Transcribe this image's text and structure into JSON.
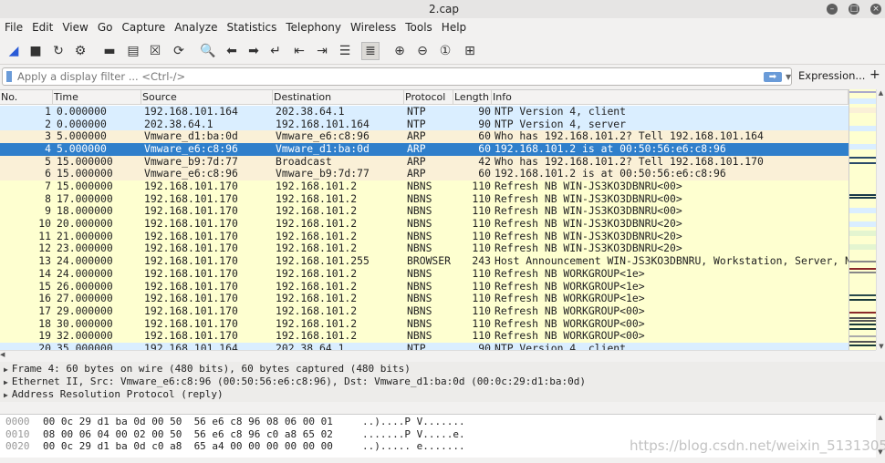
{
  "window": {
    "title": "2.cap"
  },
  "menu": [
    "File",
    "Edit",
    "View",
    "Go",
    "Capture",
    "Analyze",
    "Statistics",
    "Telephony",
    "Wireless",
    "Tools",
    "Help"
  ],
  "toolbar_icons": [
    "start-capture-icon",
    "stop-capture-icon",
    "restart-capture-icon",
    "capture-options-icon",
    "open-file-icon",
    "save-file-icon",
    "close-file-icon",
    "reload-file-icon",
    "find-packet-icon",
    "go-back-icon",
    "go-forward-icon",
    "go-to-packet-icon",
    "first-packet-icon",
    "last-packet-icon",
    "autoscroll-icon",
    "colorize-icon",
    "zoom-in-icon",
    "zoom-out-icon",
    "normal-size-icon",
    "resize-columns-icon"
  ],
  "filter": {
    "placeholder": "Apply a display filter ... <Ctrl-/>",
    "expression_label": "Expression...",
    "plus_label": "+"
  },
  "columns": [
    "No.",
    "Time",
    "Source",
    "Destination",
    "Protocol",
    "Length",
    "Info"
  ],
  "colors": {
    "NTP": "#daeeff",
    "ARP": "#faf0d7",
    "NBNS": "#feffd0",
    "BROWSER": "#feffd0",
    "selected": "#2f7fcb"
  },
  "selected_packet": 4,
  "packets": [
    {
      "no": "1",
      "time": "0.000000",
      "src": "192.168.101.164",
      "dst": "202.38.64.1",
      "proto": "NTP",
      "len": "90",
      "info": "NTP Version 4, client"
    },
    {
      "no": "2",
      "time": "0.000000",
      "src": "202.38.64.1",
      "dst": "192.168.101.164",
      "proto": "NTP",
      "len": "90",
      "info": "NTP Version 4, server"
    },
    {
      "no": "3",
      "time": "5.000000",
      "src": "Vmware_d1:ba:0d",
      "dst": "Vmware_e6:c8:96",
      "proto": "ARP",
      "len": "60",
      "info": "Who has 192.168.101.2? Tell 192.168.101.164"
    },
    {
      "no": "4",
      "time": "5.000000",
      "src": "Vmware_e6:c8:96",
      "dst": "Vmware_d1:ba:0d",
      "proto": "ARP",
      "len": "60",
      "info": "192.168.101.2 is at 00:50:56:e6:c8:96"
    },
    {
      "no": "5",
      "time": "15.000000",
      "src": "Vmware_b9:7d:77",
      "dst": "Broadcast",
      "proto": "ARP",
      "len": "42",
      "info": "Who has 192.168.101.2? Tell 192.168.101.170"
    },
    {
      "no": "6",
      "time": "15.000000",
      "src": "Vmware_e6:c8:96",
      "dst": "Vmware_b9:7d:77",
      "proto": "ARP",
      "len": "60",
      "info": "192.168.101.2 is at 00:50:56:e6:c8:96"
    },
    {
      "no": "7",
      "time": "15.000000",
      "src": "192.168.101.170",
      "dst": "192.168.101.2",
      "proto": "NBNS",
      "len": "110",
      "info": "Refresh NB WIN-JS3KO3DBNRU<00>"
    },
    {
      "no": "8",
      "time": "17.000000",
      "src": "192.168.101.170",
      "dst": "192.168.101.2",
      "proto": "NBNS",
      "len": "110",
      "info": "Refresh NB WIN-JS3KO3DBNRU<00>"
    },
    {
      "no": "9",
      "time": "18.000000",
      "src": "192.168.101.170",
      "dst": "192.168.101.2",
      "proto": "NBNS",
      "len": "110",
      "info": "Refresh NB WIN-JS3KO3DBNRU<00>"
    },
    {
      "no": "10",
      "time": "20.000000",
      "src": "192.168.101.170",
      "dst": "192.168.101.2",
      "proto": "NBNS",
      "len": "110",
      "info": "Refresh NB WIN-JS3KO3DBNRU<20>"
    },
    {
      "no": "11",
      "time": "21.000000",
      "src": "192.168.101.170",
      "dst": "192.168.101.2",
      "proto": "NBNS",
      "len": "110",
      "info": "Refresh NB WIN-JS3KO3DBNRU<20>"
    },
    {
      "no": "12",
      "time": "23.000000",
      "src": "192.168.101.170",
      "dst": "192.168.101.2",
      "proto": "NBNS",
      "len": "110",
      "info": "Refresh NB WIN-JS3KO3DBNRU<20>"
    },
    {
      "no": "13",
      "time": "24.000000",
      "src": "192.168.101.170",
      "dst": "192.168.101.255",
      "proto": "BROWSER",
      "len": "243",
      "info": "Host Announcement WIN-JS3KO3DBNRU, Workstation, Server, N"
    },
    {
      "no": "14",
      "time": "24.000000",
      "src": "192.168.101.170",
      "dst": "192.168.101.2",
      "proto": "NBNS",
      "len": "110",
      "info": "Refresh NB WORKGROUP<1e>"
    },
    {
      "no": "15",
      "time": "26.000000",
      "src": "192.168.101.170",
      "dst": "192.168.101.2",
      "proto": "NBNS",
      "len": "110",
      "info": "Refresh NB WORKGROUP<1e>"
    },
    {
      "no": "16",
      "time": "27.000000",
      "src": "192.168.101.170",
      "dst": "192.168.101.2",
      "proto": "NBNS",
      "len": "110",
      "info": "Refresh NB WORKGROUP<1e>"
    },
    {
      "no": "17",
      "time": "29.000000",
      "src": "192.168.101.170",
      "dst": "192.168.101.2",
      "proto": "NBNS",
      "len": "110",
      "info": "Refresh NB WORKGROUP<00>"
    },
    {
      "no": "18",
      "time": "30.000000",
      "src": "192.168.101.170",
      "dst": "192.168.101.2",
      "proto": "NBNS",
      "len": "110",
      "info": "Refresh NB WORKGROUP<00>"
    },
    {
      "no": "19",
      "time": "32.000000",
      "src": "192.168.101.170",
      "dst": "192.168.101.2",
      "proto": "NBNS",
      "len": "110",
      "info": "Refresh NB WORKGROUP<00>"
    },
    {
      "no": "20",
      "time": "35.000000",
      "src": "192.168.101.164",
      "dst": "202.38.64.1",
      "proto": "NTP",
      "len": "90",
      "info": "NTP Version 4, client"
    }
  ],
  "details": [
    "Frame 4: 60 bytes on wire (480 bits), 60 bytes captured (480 bits)",
    "Ethernet II, Src: Vmware_e6:c8:96 (00:50:56:e6:c8:96), Dst: Vmware_d1:ba:0d (00:0c:29:d1:ba:0d)",
    "Address Resolution Protocol (reply)"
  ],
  "bytes": [
    {
      "offset": "0000",
      "hex": "00 0c 29 d1 ba 0d 00 50  56 e6 c8 96 08 06 00 01",
      "ascii": "..)....P V......."
    },
    {
      "offset": "0010",
      "hex": "08 00 06 04 00 02 00 50  56 e6 c8 96 c0 a8 65 02",
      "ascii": ".......P V.....e."
    },
    {
      "offset": "0020",
      "hex": "00 0c 29 d1 ba 0d c0 a8  65 a4 00 00 00 00 00 00",
      "ascii": "..)..... e......."
    }
  ],
  "watermark": "https://blog.csdn.net/weixin_51313054"
}
